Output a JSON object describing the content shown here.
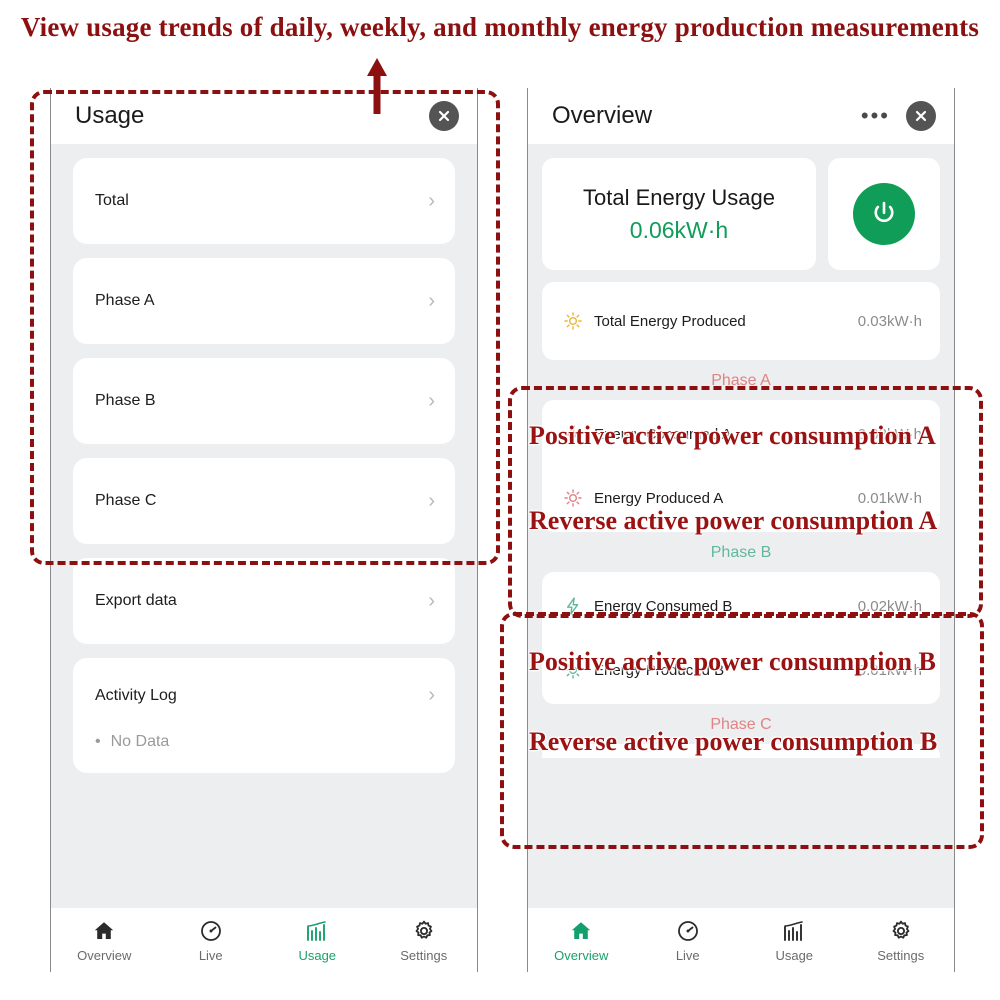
{
  "annotation": {
    "title": "View usage trends of daily, weekly, and monthly energy production measurements",
    "arrow_icon": "up-arrow-icon",
    "color": "#8c1010",
    "labels": [
      {
        "text": "Positive active power consumption A"
      },
      {
        "text": "Reverse active power consumption A"
      },
      {
        "text": "Positive active power consumption B"
      },
      {
        "text": "Reverse active power consumption B"
      }
    ]
  },
  "left_panel": {
    "appbar": {
      "title": "Usage",
      "close_icon": "close-circle-icon"
    },
    "items": [
      {
        "label": "Total",
        "chevron": "chevron-right-icon"
      },
      {
        "label": "Phase A",
        "chevron": "chevron-right-icon"
      },
      {
        "label": "Phase B",
        "chevron": "chevron-right-icon"
      },
      {
        "label": "Phase C",
        "chevron": "chevron-right-icon"
      },
      {
        "label": "Export data",
        "chevron": "chevron-right-icon"
      }
    ],
    "activity_log": {
      "label": "Activity Log",
      "chevron": "chevron-right-icon",
      "bullet": "•",
      "empty_text": "No Data"
    },
    "nav": [
      {
        "label": "Overview",
        "icon": "home-icon",
        "active": false
      },
      {
        "label": "Live",
        "icon": "gauge-icon",
        "active": false
      },
      {
        "label": "Usage",
        "icon": "bar-chart-icon",
        "active": true
      },
      {
        "label": "Settings",
        "icon": "gear-icon",
        "active": false
      }
    ]
  },
  "right_panel": {
    "appbar": {
      "title": "Overview",
      "more_icon": "more-horizontal-icon",
      "close_icon": "close-circle-icon",
      "more_glyph": "•••"
    },
    "total_usage": {
      "label": "Total Energy Usage",
      "value": "0.06kW·h",
      "value_color": "#0f9d58"
    },
    "power_button": {
      "icon": "power-icon",
      "color": "#0f9d58"
    },
    "total_produced": {
      "icon": "sun-icon",
      "icon_color": "#e9b63a",
      "label": "Total Energy Produced",
      "value": "0.03kW·h"
    },
    "phases": [
      {
        "name": "Phase A",
        "name_color": "#e08484",
        "rows": [
          {
            "icon": "bolt-icon",
            "icon_color": "#e08484",
            "label": "Energy Consumed A",
            "value": "0.02kW·h"
          },
          {
            "icon": "sun-icon",
            "icon_color": "#e08484",
            "label": "Energy Produced A",
            "value": "0.01kW·h"
          }
        ]
      },
      {
        "name": "Phase B",
        "name_color": "#63b79a",
        "rows": [
          {
            "icon": "bolt-icon",
            "icon_color": "#63b79a",
            "label": "Energy Consumed B",
            "value": "0.02kW·h"
          },
          {
            "icon": "sun-icon",
            "icon_color": "#63b79a",
            "label": "Energy Produced B",
            "value": "0.01kW·h"
          }
        ]
      },
      {
        "name": "Phase C",
        "name_color": "#e08484",
        "rows": []
      }
    ],
    "nav": [
      {
        "label": "Overview",
        "icon": "home-icon",
        "active": true
      },
      {
        "label": "Live",
        "icon": "gauge-icon",
        "active": false
      },
      {
        "label": "Usage",
        "icon": "bar-chart-icon",
        "active": false
      },
      {
        "label": "Settings",
        "icon": "gear-icon",
        "active": false
      }
    ]
  }
}
